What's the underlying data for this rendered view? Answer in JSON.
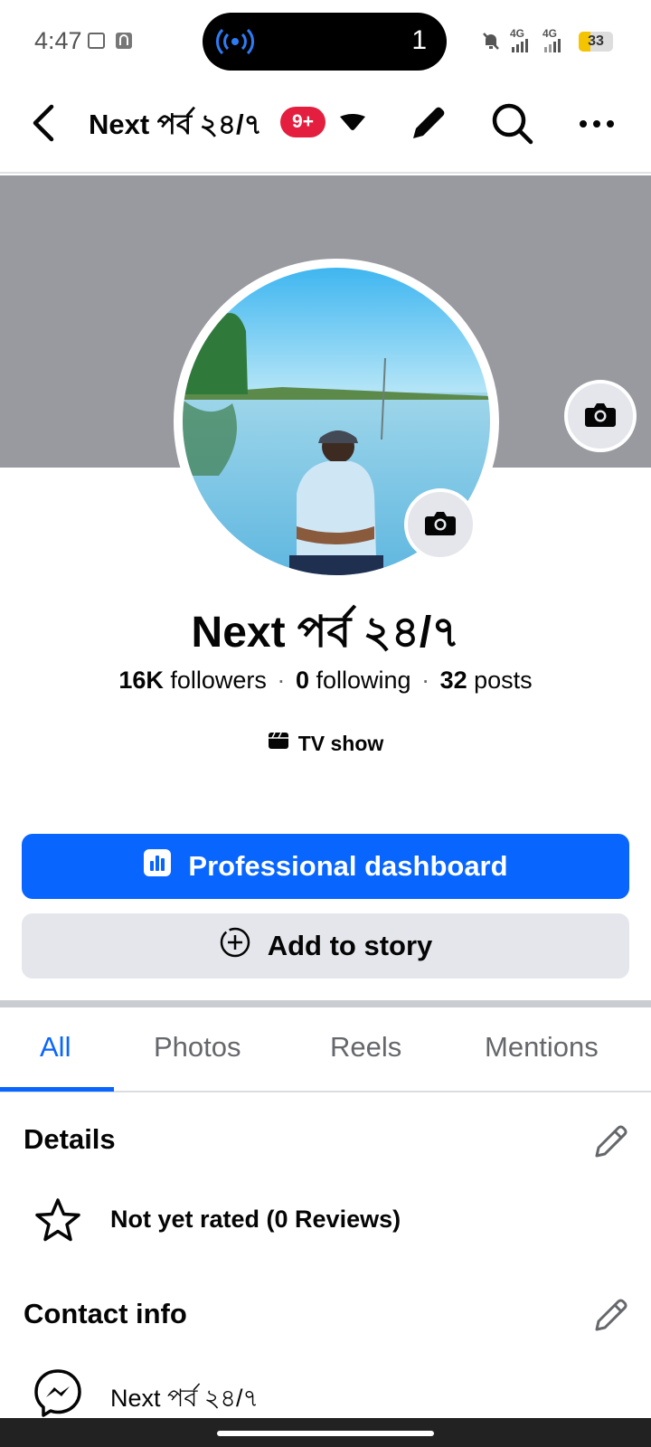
{
  "status_bar": {
    "time": "4:47",
    "notification_count": "1",
    "network_1": "4G",
    "network_2": "4G",
    "battery": "33",
    "battery_level": 0.33,
    "icons": [
      "screenshot-icon",
      "app-icon",
      "hotspot-icon",
      "mute-icon",
      "signal-icon",
      "signal-icon",
      "battery-icon"
    ]
  },
  "header": {
    "title": "Next পর্ব ২৪/৭",
    "badge": "9+",
    "icons": [
      "back-arrow-icon",
      "dropdown-caret-icon",
      "pencil-icon",
      "search-icon",
      "more-icon"
    ]
  },
  "profile": {
    "name": "Next পর্ব ২৪/৭",
    "followers_count": "16K",
    "followers_label": "followers",
    "following_count": "0",
    "following_label": "following",
    "posts_count": "32",
    "posts_label": "posts",
    "separator": "·",
    "category": "TV show"
  },
  "actions": {
    "primary_label": "Professional dashboard",
    "secondary_label": "Add to story"
  },
  "tabs": [
    {
      "label": "All",
      "active": true
    },
    {
      "label": "Photos",
      "active": false
    },
    {
      "label": "Reels",
      "active": false
    },
    {
      "label": "Mentions",
      "active": false
    }
  ],
  "details": {
    "title": "Details",
    "rating_text": "Not yet rated (0 Reviews)"
  },
  "contact_info": {
    "title": "Contact info",
    "messenger_text": "Next পর্ব ২৪/৭"
  },
  "colors": {
    "accent": "#0866ff",
    "badge": "#e41e3f",
    "cover": "#989a9f",
    "secondary_button": "#e4e6eb"
  }
}
